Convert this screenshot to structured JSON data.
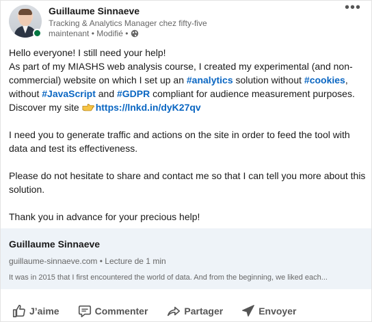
{
  "author": {
    "name": "Guillaume Sinnaeve",
    "headline": "Tracking & Analytics Manager chez fifty-five",
    "meta": "maintenant • Modifié •"
  },
  "post": {
    "p1_line1": "Hello everyone! I still need your help!",
    "p1_a": "As part of my MIASHS web analysis course, I created my experimental (and non-commercial) website on which I set up an ",
    "tag_analytics": "#analytics",
    "p1_b": " solution without ",
    "tag_cookies": "#cookies",
    "p1_c": ", without ",
    "tag_javascript": "#JavaScript",
    "p1_d": " and ",
    "tag_gdpr": "#GDPR",
    "p1_e": " compliant for audience measurement purposes.",
    "p1_f": "Discover my site",
    "link": "https://lnkd.in/dyK27qv",
    "p2": "I need you to generate traffic and actions on the site in order to feed the tool with data and test its effectiveness.",
    "p3": "Please do not hesitate to share and contact me so that I can tell you more about this solution.",
    "p4": "Thank you in advance for your precious help!"
  },
  "preview": {
    "title": "Guillaume Sinnaeve",
    "meta": "guillaume-sinnaeve.com • Lecture de 1 min",
    "excerpt": "It was in 2015 that I first encountered the world of data. And from the beginning, we liked each..."
  },
  "actions": {
    "like": "J’aime",
    "comment": "Commenter",
    "share": "Partager",
    "send": "Envoyer"
  },
  "colors": {
    "accent": "#0a66c2",
    "online": "#057642",
    "preview_bg": "#eef3f8"
  },
  "icons": [
    "globe-icon",
    "more-icon",
    "pointing-hand-icon",
    "like-icon",
    "comment-icon",
    "share-icon",
    "send-icon"
  ]
}
